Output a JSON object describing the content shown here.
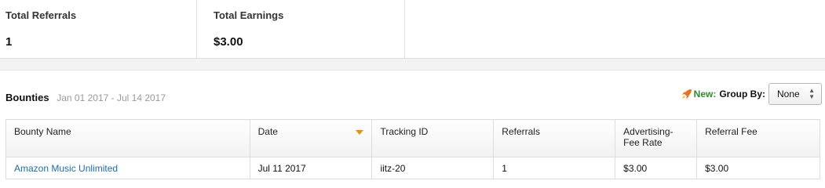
{
  "summary": {
    "total_referrals_label": "Total Referrals",
    "total_referrals_value": "1",
    "total_earnings_label": "Total Earnings",
    "total_earnings_value": "$3.00"
  },
  "bounties": {
    "title": "Bounties",
    "date_range": "Jan 01 2017 - Jul 14 2017",
    "new_label": "New:",
    "group_by_label": "Group By:",
    "group_by_value": "None"
  },
  "table": {
    "headers": {
      "bounty_name": "Bounty Name",
      "date": "Date",
      "tracking_id": "Tracking ID",
      "referrals": "Referrals",
      "advertising_fee_rate_1": "Advertising-",
      "advertising_fee_rate_2": "Fee Rate",
      "referral_fee": "Referral Fee"
    },
    "rows": [
      {
        "bounty_name": "Amazon Music Unlimited",
        "date": "Jul 11 2017",
        "tracking_id": "iitz-20",
        "referrals": "1",
        "advertising_fee_rate": "$3.00",
        "referral_fee": "$3.00"
      }
    ]
  },
  "colors": {
    "link": "#1a6fae",
    "new_badge": "#2e8b2e",
    "sort_arrow": "#e8910b",
    "rocket": "#e8731c"
  },
  "icons": {
    "new_badge_icon": "rocket-icon",
    "sort_indicator": "sort-desc-icon",
    "select_arrows": "up-down-arrows-icon"
  }
}
